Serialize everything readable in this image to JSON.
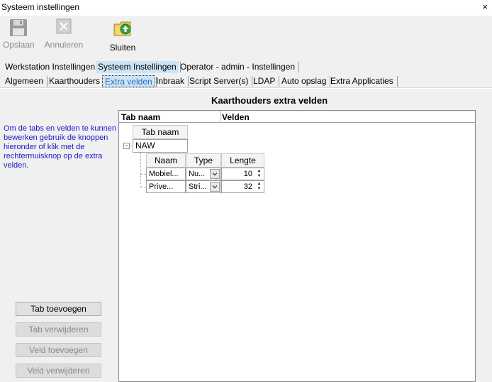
{
  "window": {
    "title": "Systeem instellingen",
    "close": "×"
  },
  "toolbar": {
    "save": {
      "label": "Opslaan",
      "icon": "floppy-disk-icon"
    },
    "cancel": {
      "label": "Annuleren",
      "icon": "cancel-icon"
    },
    "close": {
      "label": "Sluiten",
      "icon": "folder-exit-icon"
    }
  },
  "tabs_top": [
    {
      "label": "Werkstation Instellingen"
    },
    {
      "label": "Systeem Instellingen"
    },
    {
      "label": "Operator - admin - Instellingen"
    }
  ],
  "tabs_sub": [
    {
      "label": "Algemeen"
    },
    {
      "label": "Kaarthouders"
    },
    {
      "label": "Extra velden"
    },
    {
      "label": "Inbraak"
    },
    {
      "label": "Script Server(s)"
    },
    {
      "label": "LDAP"
    },
    {
      "label": "Auto opslag"
    },
    {
      "label": "Extra Applicaties"
    }
  ],
  "help_text": "Om de tabs en velden te kunnen bewerken gebruik de knoppen hieronder of klik met de rechtermuisknop op de extra velden.",
  "buttons": {
    "add_tab": "Tab toevoegen",
    "remove_tab": "Tab verwijderen",
    "add_field": "Veld toevoegen",
    "remove_field": "Veld verwijderen"
  },
  "panel": {
    "heading": "Kaarthouders extra velden",
    "col_tab": "Tab naam",
    "col_fields": "Velden",
    "tab_header": "Tab naam",
    "tab_name": "NAW",
    "field_headers": {
      "name": "Naam",
      "type": "Type",
      "length": "Lengte"
    },
    "fields": [
      {
        "name": "Mobiel...",
        "type": "Nu...",
        "length": "10"
      },
      {
        "name": "Prive...",
        "type": "Stri...",
        "length": "32"
      }
    ]
  }
}
